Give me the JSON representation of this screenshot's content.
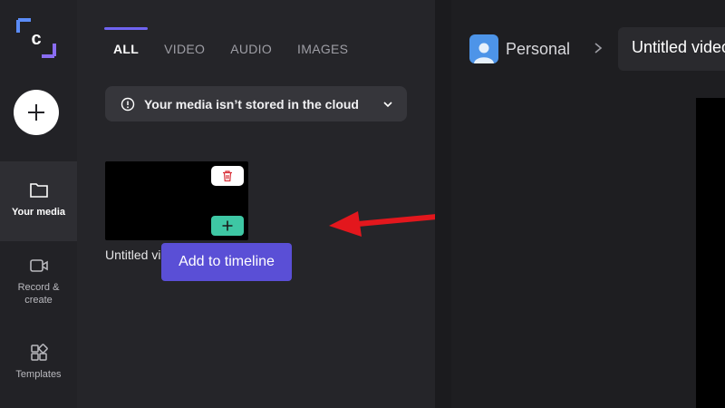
{
  "rail": {
    "create_label": "+",
    "items": [
      {
        "label": "Your media",
        "icon": "folder-icon",
        "active": true
      },
      {
        "label": "Record &\ncreate",
        "icon": "camera-icon",
        "active": false
      },
      {
        "label": "Templates",
        "icon": "templates-icon",
        "active": false
      }
    ]
  },
  "tabs": [
    {
      "label": "ALL",
      "active": true
    },
    {
      "label": "VIDEO",
      "active": false
    },
    {
      "label": "AUDIO",
      "active": false
    },
    {
      "label": "IMAGES",
      "active": false
    }
  ],
  "banner": {
    "text": "Your media isn’t stored in the cloud"
  },
  "media_item": {
    "title": "Untitled video"
  },
  "tooltip": {
    "text": "Add to timeline"
  },
  "header": {
    "workspace": "Personal",
    "project_title": "Untitled video"
  },
  "colors": {
    "accent": "#6f63f0",
    "tooltip": "#5a4fd6",
    "add": "#3ec7a4",
    "arrow": "#e3171d"
  }
}
